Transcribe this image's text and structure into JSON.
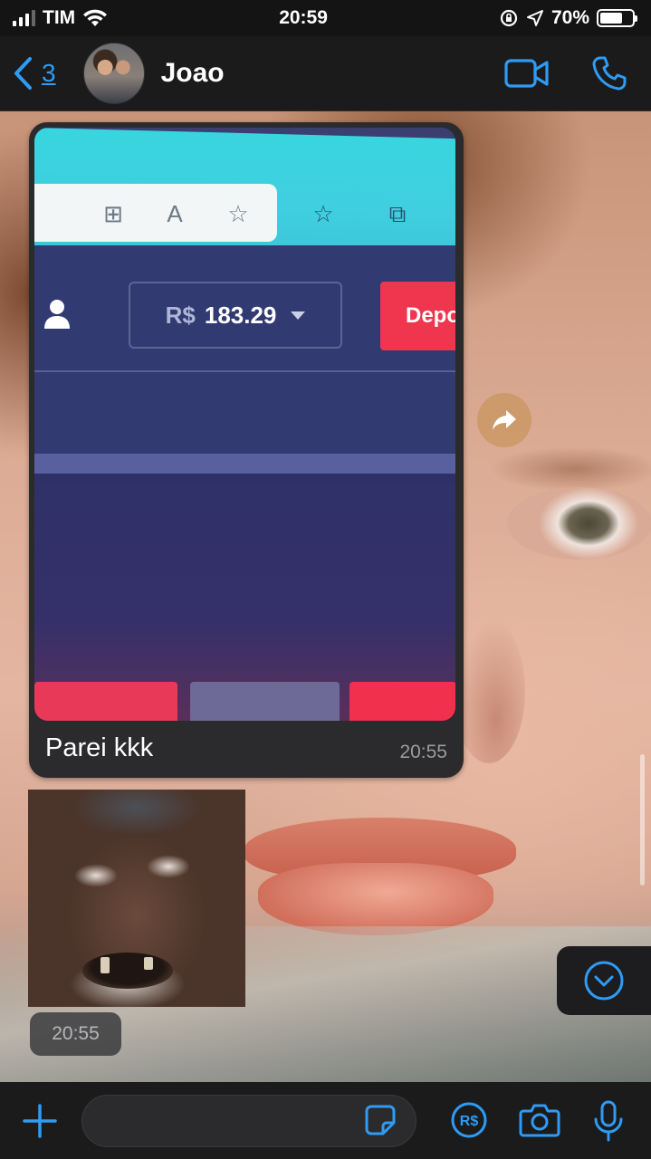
{
  "status_bar": {
    "carrier": "TIM",
    "time": "20:59",
    "battery": "70%",
    "battery_level": 0.7
  },
  "header": {
    "back_count": "3",
    "contact_name": "Joao",
    "actions": [
      "video-camera-icon",
      "phone-icon"
    ]
  },
  "messages": [
    {
      "type": "image",
      "embedded_screenshot": {
        "balance_currency": "R$",
        "balance_amount": "183.29",
        "deposit_button": "Depo"
      },
      "caption": "Parei kkk",
      "time": "20:55"
    },
    {
      "type": "image",
      "time": "20:55"
    }
  ],
  "composer": {
    "input_value": "",
    "icons": [
      "plus-icon",
      "sticker-icon",
      "payment-icon",
      "camera-icon",
      "microphone-icon"
    ]
  },
  "colors": {
    "accent": "#2f9bf5",
    "bubble": "#2b2b2d",
    "bar_background": "#1b1b1b"
  }
}
